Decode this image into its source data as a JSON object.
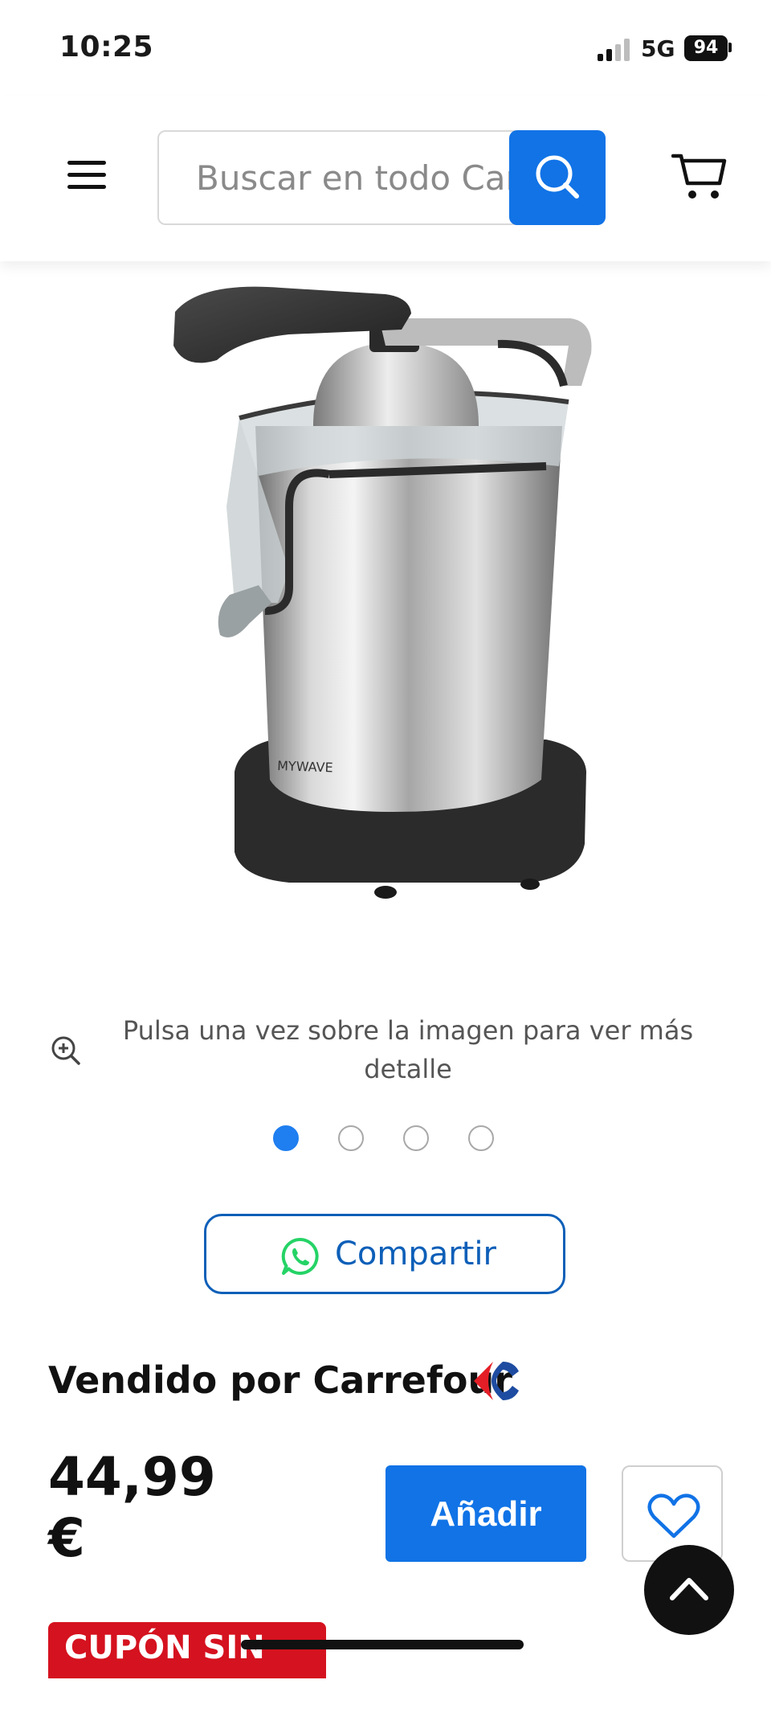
{
  "status_bar": {
    "time": "10:25",
    "network": "5G",
    "battery": "94"
  },
  "header": {
    "search_placeholder": "Buscar en todo Carrefour",
    "icons": {
      "menu": "hamburger-icon",
      "search": "search-icon",
      "cart": "cart-icon"
    }
  },
  "gallery": {
    "image_alt": "Exprimidor MYWAVE de acero inoxidable",
    "brand_on_product": "MYWAVE",
    "zoom_hint": "Pulsa una vez sobre la imagen para ver más detalle",
    "dots": [
      {
        "active": true
      },
      {
        "active": false
      },
      {
        "active": false
      },
      {
        "active": false
      }
    ]
  },
  "share": {
    "label": "Compartir",
    "icon": "whatsapp-icon"
  },
  "seller": {
    "label": "Vendido por Carrefour"
  },
  "price": {
    "value": "44,99",
    "currency": "€"
  },
  "actions": {
    "add_label": "Añadir",
    "favorite_icon": "heart-icon",
    "scroll_top_icon": "chevron-up-icon"
  },
  "badge": {
    "coupon": "CUPÓN SIN IVA"
  },
  "colors": {
    "primary": "#1173e6",
    "share_border": "#0d5fb8",
    "coupon_red": "#d5121f",
    "whatsapp_green": "#25d366"
  }
}
